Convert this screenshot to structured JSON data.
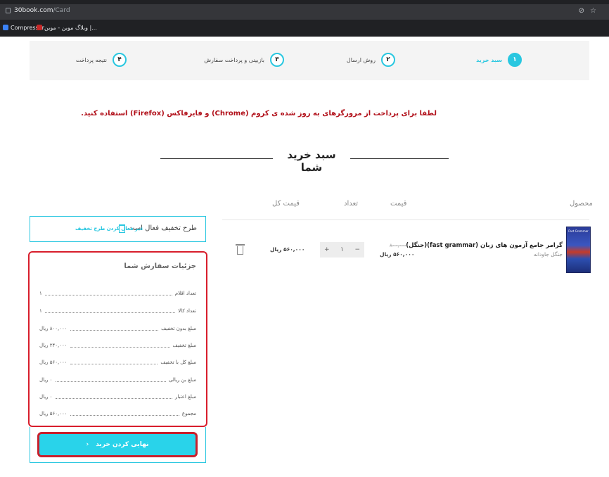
{
  "browser": {
    "address_host": "30book.com",
    "address_path": "/Card",
    "bookmarks": [
      {
        "label": "Compressor",
        "color": "#3b82f6"
      },
      {
        "label": "وبلاگ موبن - موبن |...",
        "color": "#c62828"
      }
    ]
  },
  "steps": [
    {
      "number": "۱",
      "label": "سبد خرید"
    },
    {
      "number": "۲",
      "label": "روش ارسال"
    },
    {
      "number": "۳",
      "label": "بازبینی و پرداخت سفارش"
    },
    {
      "number": "۴",
      "label": "نتیجه پرداخت"
    }
  ],
  "warning": "لطفا برای پرداخت از مرورگرهای به روز شده ی کروم (Chrome) و فایرفاکس (Firefox) استفاده کنید.",
  "page_title": "سبد خرید شما",
  "columns": {
    "product": "محصول",
    "price": "قیمت",
    "qty": "تعداد",
    "total": "قیمت کل"
  },
  "cart_item": {
    "cover_text": "Fast Grammar",
    "name": "گرامر جامع آزمون های زبان (fast grammar)(جنگل)",
    "publisher": "جنگل جاودانه",
    "old_price": "۸۰۰,۰۰۰",
    "price": "۵۶۰,۰۰۰ ریال",
    "qty_minus": "−",
    "qty": "۱",
    "qty_plus": "+",
    "total": "۵۶۰,۰۰۰ ریال"
  },
  "discount": {
    "status": "طرح تخفیف فعال است.",
    "link": "غیر فعال کردن طرح تخفیف"
  },
  "summary": {
    "title": "جزئیات سفارش شما",
    "rows": [
      {
        "label": "تعداد اقلام",
        "value": "۱"
      },
      {
        "label": "تعداد کالا",
        "value": "۱"
      },
      {
        "label": "مبلغ بدون تخفیف",
        "value": "۸۰۰,۰۰۰ ریال"
      },
      {
        "label": "مبلغ تخفیف",
        "value": "۲۴۰,۰۰۰ ریال"
      },
      {
        "label": "مبلغ کل با تخفیف",
        "value": "۵۶۰,۰۰۰ ریال"
      },
      {
        "label": "مبلغ بن ریالی",
        "value": "۰ ریال"
      },
      {
        "label": "مبلغ اعتبار",
        "value": "۰ ریال"
      },
      {
        "label": "مجموع",
        "value": "۵۶۰,۰۰۰ ریال"
      }
    ]
  },
  "checkout": {
    "label": "نهایی کردن خرید",
    "chevron": "‹"
  },
  "colors": {
    "accent": "#29c7e0",
    "highlight": "#d81e2c",
    "warning": "#b1101a"
  }
}
